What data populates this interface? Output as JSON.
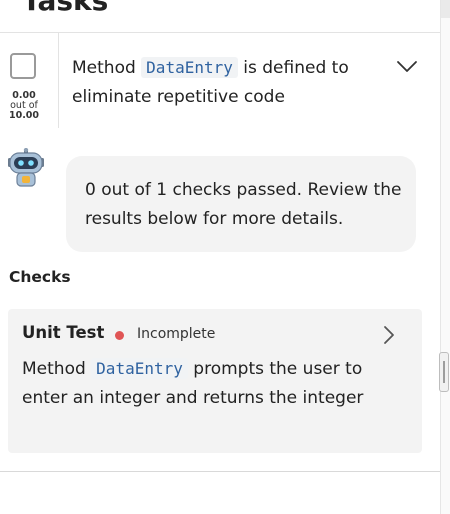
{
  "header": {
    "title": "Tasks"
  },
  "task": {
    "score_value": "0.00",
    "score_mid": "out of",
    "score_max": "10.00",
    "desc_pre": "Method",
    "desc_code": "DataEntry",
    "desc_post": "is defined to eliminate repetitive code",
    "expand_icon": "chevron-down-icon"
  },
  "assistant": {
    "avatar_icon": "robot-icon",
    "message": "0 out of 1 checks passed. Review the results below for more details."
  },
  "checks": {
    "label": "Checks",
    "items": [
      {
        "title": "Unit Test",
        "status": "Incomplete",
        "status_color": "#e05555",
        "text_pre": "Method",
        "code": "DataEntry",
        "text_post": "prompts the user to enter an integer and returns the integer",
        "open_icon": "chevron-right-icon"
      }
    ]
  }
}
